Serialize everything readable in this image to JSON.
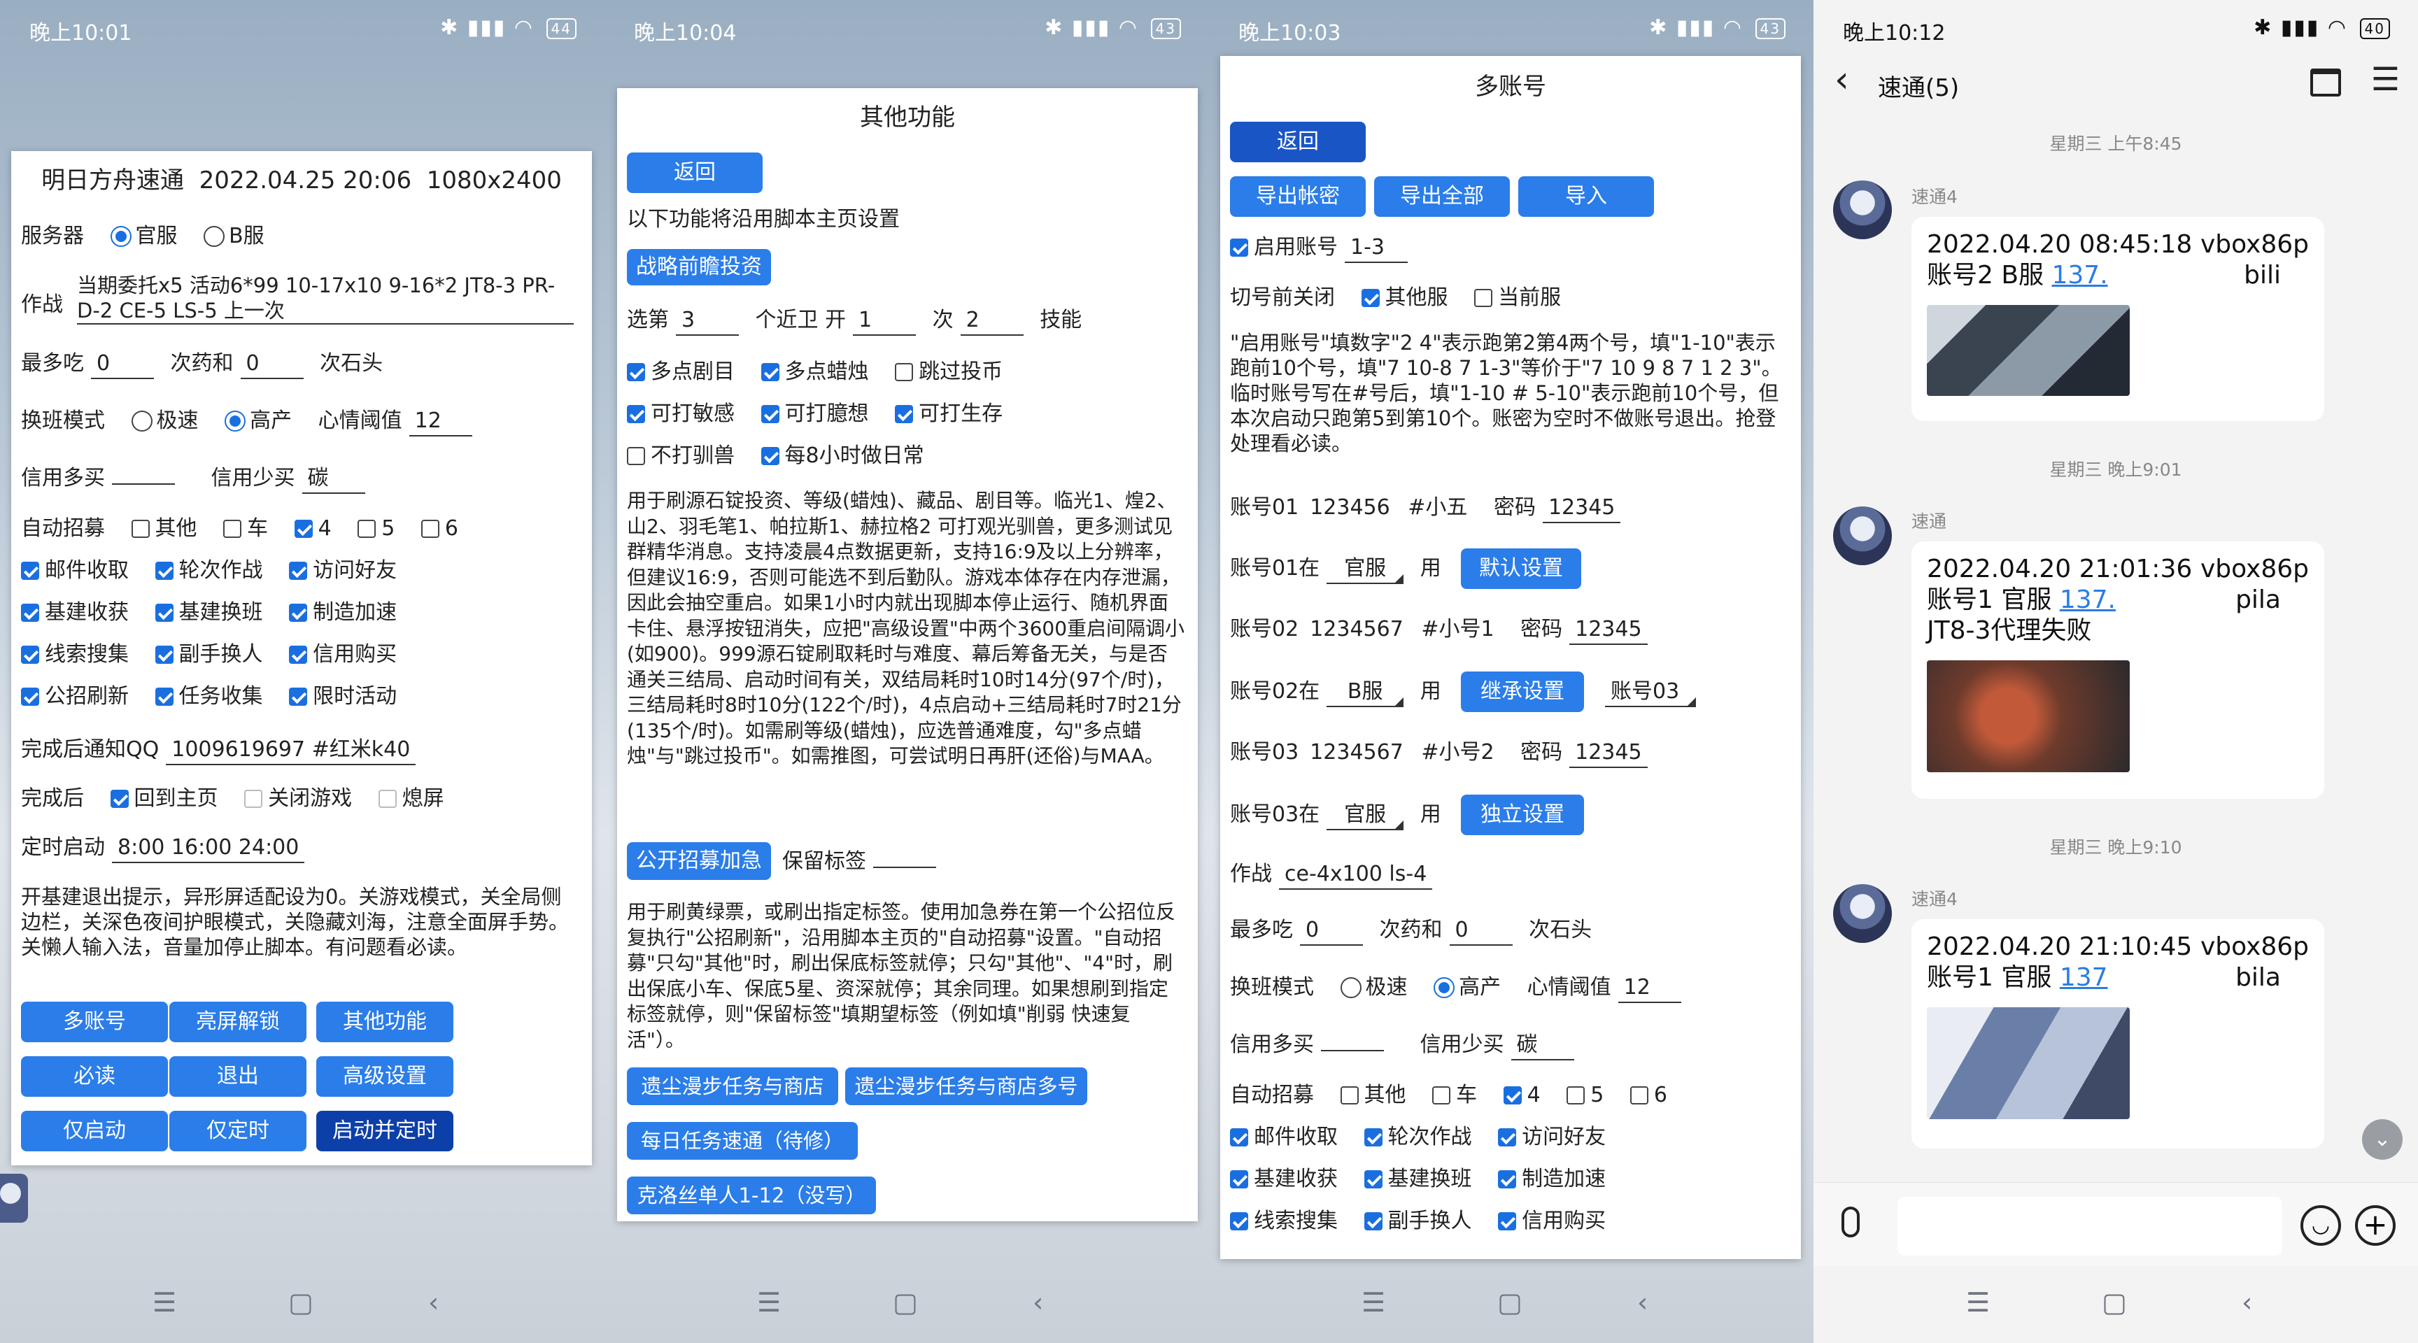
{
  "status": {
    "p1": {
      "time": "晚上10:01",
      "battery": "44"
    },
    "p2": {
      "time": "晚上10:04",
      "battery": "43"
    },
    "p3": {
      "time": "晚上10:03",
      "battery": "43"
    },
    "p4": {
      "time": "晚上10:12",
      "battery": "40"
    }
  },
  "main": {
    "title": "明日方舟速通  2022.04.25 20:06  1080x2400",
    "server_label": "服务器",
    "server_options": [
      "官服",
      "B服"
    ],
    "battle_label": "作战",
    "battle_value": "当期委托x5 活动6*99 10-17x10 9-16*2 JT8-3 PR-D-2 CE-5 LS-5 上一次",
    "eat_label": "最多吃",
    "eat_value": "0",
    "eat_mid": "次药和",
    "stone_value": "0",
    "eat_end": "次石头",
    "shift_label": "换班模式",
    "shift_options": [
      "极速",
      "高产"
    ],
    "mood_label": "心情阈值",
    "mood_value": "12",
    "credit_more": "信用多买",
    "credit_less": "信用少买",
    "credit_less_value": "碳",
    "recruit_label": "自动招募",
    "recruit_opts": [
      "其他",
      "车",
      "4",
      "5",
      "6"
    ],
    "tasks": [
      [
        "邮件收取",
        "轮次作战",
        "访问好友"
      ],
      [
        "基建收获",
        "基建换班",
        "制造加速"
      ],
      [
        "线索搜集",
        "副手换人",
        "信用购买"
      ],
      [
        "公招刷新",
        "任务收集",
        "限时活动"
      ]
    ],
    "qq_label": "完成后通知QQ",
    "qq_value": "1009619697 #红米k40",
    "after_label": "完成后",
    "after_opts": [
      "回到主页",
      "关闭游戏",
      "熄屏"
    ],
    "timer_label": "定时启动",
    "timer_value": "8:00 16:00 24:00",
    "note": "开基建退出提示，异形屏适配设为0。关游戏模式，关全局侧边栏，关深色夜间护眼模式，关隐藏刘海，注意全面屏手势。关懒人输入法，音量加停止脚本。有问题看必读。",
    "buttons": [
      "多账号",
      "亮屏解锁",
      "其他功能",
      "必读",
      "退出",
      "高级设置",
      "仅启动",
      "仅定时",
      "启动并定时"
    ]
  },
  "other": {
    "title": "其他功能",
    "back": "返回",
    "intro": "以下功能将沿用脚本主页设置",
    "invest_btn": "战略前瞻投资",
    "sel_label": "选第",
    "sel_value": "3",
    "guard_label": "个近卫 开",
    "guard_value": "1",
    "times_label": "次",
    "times_value": "2",
    "skill_label": "技能",
    "opts": [
      [
        "多点剧目",
        "多点蜡烛",
        "跳过投币"
      ],
      [
        "可打敏感",
        "可打臆想",
        "可打生存"
      ],
      [
        "不打驯兽",
        "每8小时做日常"
      ]
    ],
    "desc1": "用于刷源石锭投资、等级(蜡烛)、藏品、剧目等。临光1、煌2、山2、羽毛笔1、帕拉斯1、赫拉格2 可打观光驯兽，更多测试见群精华消息。支持凌晨4点数据更新，支持16:9及以上分辨率，但建议16:9，否则可能选不到后勤队。游戏本体存在内存泄漏，因此会抽空重启。如果1小时内就出现脚本停止运行、随机界面卡住、悬浮按钮消失，应把\"高级设置\"中两个3600重启间隔调小(如900)。999源石锭刷取耗时与难度、幕后筹备无关，与是否通关三结局、启动时间有关，双结局耗时10时14分(97个/时)，三结局耗时8时10分(122个/时)，4点启动+三结局耗时7时21分(135个/时)。如需刷等级(蜡烛)，应选普通难度，勾\"多点蜡烛\"与\"跳过投币\"。如需推图，可尝试明日再肝(还俗)与MAA。",
    "recruit_btn": "公开招募加急",
    "keep_label": "保留标签",
    "desc2": "用于刷黄绿票，或刷出指定标签。使用加急券在第一个公招位反复执行\"公招刷新\"，沿用脚本主页的\"自动招募\"设置。\"自动招募\"只勾\"其他\"时，刷出保底标签就停；只勾\"其他\"、\"4\"时，刷出保底小车、保底5星、资深就停；其余同理。如果想刷到指定标签就停，则\"保留标签\"填期望标签（例如填\"削弱 快速复活\"）。",
    "btn_a": "遗尘漫步任务与商店",
    "btn_b": "遗尘漫步任务与商店多号",
    "btn_c": "每日任务速通（待修）",
    "btn_d": "克洛丝单人1-12（没写）"
  },
  "multi": {
    "title": "多账号",
    "back": "返回",
    "export_pw": "导出帐密",
    "export_all": "导出全部",
    "import": "导入",
    "enable_label": "启用账号",
    "enable_value": "1-3",
    "close_label": "切号前关闭",
    "close_opts": [
      "其他服",
      "当前服"
    ],
    "desc": "\"启用账号\"填数字\"2 4\"表示跑第2第4两个号，填\"1-10\"表示跑前10个号，填\"7 10-8 7 1-3\"等价于\"7 10 9 8 7 1 2 3\"。临时账号写在#号后，填\"1-10 # 5-10\"表示跑前10个号，但本次启动只跑第5到第10个。账密为空时不做账号退出。抢登处理看必读。",
    "acc1": {
      "label": "账号01",
      "id": "123456",
      "note": "#小五",
      "pw_label": "密码",
      "pw": "12345"
    },
    "acc1s": {
      "label": "账号01在",
      "server": "官服",
      "use": "用",
      "btn": "默认设置"
    },
    "acc2": {
      "label": "账号02",
      "id": "1234567",
      "note": "#小号1",
      "pw_label": "密码",
      "pw": "12345"
    },
    "acc2s": {
      "label": "账号02在",
      "server": "B服",
      "use": "用",
      "btn": "继承设置",
      "inherit": "账号03"
    },
    "acc3": {
      "label": "账号03",
      "id": "1234567",
      "note": "#小号2",
      "pw_label": "密码",
      "pw": "12345"
    },
    "acc3s": {
      "label": "账号03在",
      "server": "官服",
      "use": "用",
      "btn": "独立设置"
    },
    "battle_label": "作战",
    "battle_value": "ce-4x100 ls-4",
    "eat_label": "最多吃",
    "eat_value": "0",
    "eat_mid": "次药和",
    "stone_value": "0",
    "eat_end": "次石头",
    "shift_label": "换班模式",
    "shift_options": [
      "极速",
      "高产"
    ],
    "mood_label": "心情阈值",
    "mood_value": "12",
    "credit_more": "信用多买",
    "credit_less": "信用少买",
    "credit_less_value": "碳",
    "recruit_label": "自动招募",
    "recruit_opts": [
      "其他",
      "车",
      "4",
      "5",
      "6"
    ],
    "tasks": [
      [
        "邮件收取",
        "轮次作战",
        "访问好友"
      ],
      [
        "基建收获",
        "基建换班",
        "制造加速"
      ],
      [
        "线索搜集",
        "副手换人",
        "信用购买"
      ]
    ]
  },
  "chat": {
    "title": "速通(5)",
    "msgs": [
      {
        "date": "星期三 上午8:45",
        "sender": "速通4",
        "line1a": "2022.04.20 08:45:18",
        "line1b": "vbox86p",
        "line2a": "账号2 B服",
        "link": "137.",
        "line2b": "bili",
        "line3": ""
      },
      {
        "date": "星期三 晚上9:01",
        "sender": "速通",
        "line1a": "2022.04.20 21:01:36",
        "line1b": "vbox86p",
        "line2a": "账号1 官服",
        "link": "137.",
        "line2b": "pila",
        "line3": "JT8-3代理失败"
      },
      {
        "date": "星期三 晚上9:10",
        "sender": "速通4",
        "line1a": "2022.04.20 21:10:45",
        "line1b": "vbox86p",
        "line2a": "账号1 官服",
        "link": "137",
        "line2b": "bila",
        "line3": ""
      }
    ]
  }
}
